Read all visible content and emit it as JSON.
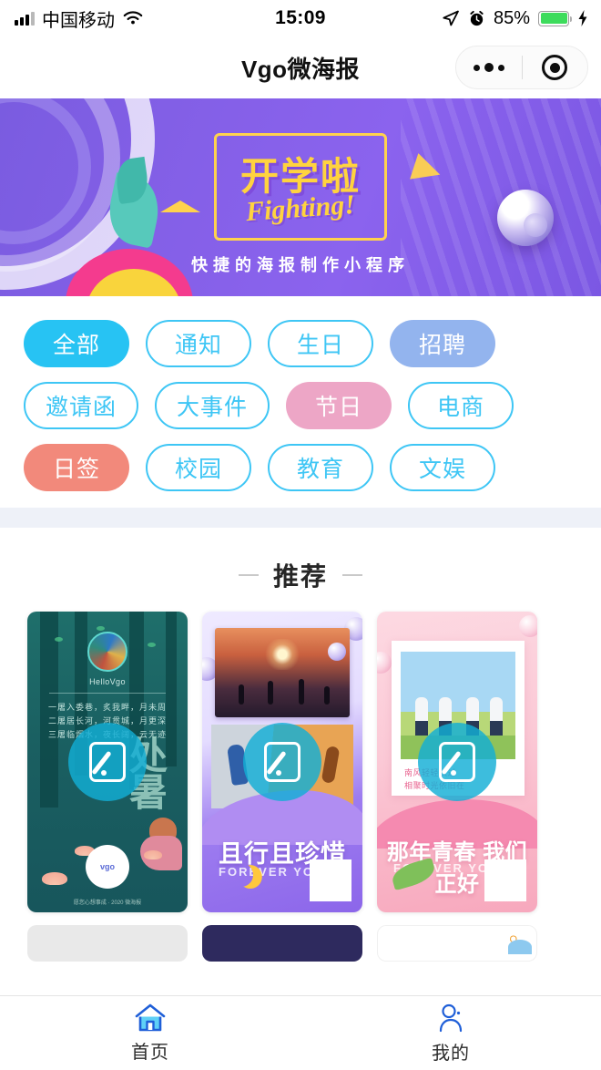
{
  "status_bar": {
    "carrier": "中国移动",
    "time": "15:09",
    "battery_percent": "85%",
    "icons": [
      "signal-bars-icon",
      "wifi-icon",
      "location-arrow-icon",
      "alarm-clock-icon",
      "battery-icon",
      "charging-bolt-icon"
    ]
  },
  "nav": {
    "title": "Vgo微海报",
    "more_icon": "more-dots-icon",
    "close_icon": "target-circle-icon"
  },
  "banner": {
    "title": "开学啦",
    "subtitle": "Fighting!",
    "tagline": "快捷的海报制作小程序",
    "bg_color": "#8560e8",
    "accent_color": "#ffd33f"
  },
  "filters": {
    "active_index": 0,
    "outline_color": "#3ec6f5",
    "items": [
      {
        "label": "全部",
        "style": "fill",
        "color": "#27c3f3"
      },
      {
        "label": "通知",
        "style": "outline",
        "color": "#3ec6f5"
      },
      {
        "label": "生日",
        "style": "outline",
        "color": "#3ec6f5"
      },
      {
        "label": "招聘",
        "style": "fill",
        "color": "#93b4ee"
      },
      {
        "label": "邀请函",
        "style": "outline",
        "color": "#3ec6f5"
      },
      {
        "label": "大事件",
        "style": "outline",
        "color": "#3ec6f5"
      },
      {
        "label": "节日",
        "style": "fill",
        "color": "#eda6c6"
      },
      {
        "label": "电商",
        "style": "outline",
        "color": "#3ec6f5"
      },
      {
        "label": "日签",
        "style": "fill",
        "color": "#f2897b"
      },
      {
        "label": "校园",
        "style": "outline",
        "color": "#3ec6f5"
      },
      {
        "label": "教育",
        "style": "outline",
        "color": "#3ec6f5"
      },
      {
        "label": "文娱",
        "style": "outline",
        "color": "#3ec6f5"
      }
    ]
  },
  "section": {
    "recommend_title": "推荐"
  },
  "posters": [
    {
      "theme": "chushu-forest",
      "handle": "HelloVgo",
      "poem": "一屠入委巷，炙我畔，月未周\n二屠居长河，河贯城，月更深\n三屠临烟水，夜长阔，云无迹",
      "big_char": "处\n暑",
      "footer": "愿您心想事成 · 2020 微海报",
      "qr_label": "vgo",
      "edit_icon": "edit-pencil-icon"
    },
    {
      "theme": "purple-youth",
      "title": "且行且珍惜",
      "subtitle": "FOREVER YOUNG",
      "edit_icon": "edit-pencil-icon",
      "qr_icon": "qr-code-icon"
    },
    {
      "theme": "pink-youth",
      "title": "那年青春 我们正好",
      "subtitle": "FOREVER YOUNG",
      "caption": "南风轻轻吹过\n相聚时光依旧在",
      "edit_icon": "edit-pencil-icon",
      "qr_icon": "qr-code-icon"
    }
  ],
  "posters_next_row": [
    {
      "color": "#e9e9e9"
    },
    {
      "color": "#2e2a5e"
    },
    {
      "color": "#ffffff"
    }
  ],
  "tabbar": {
    "active_index": 0,
    "active_color": "#1f5fd8",
    "items": [
      {
        "label": "首页",
        "icon": "home-icon"
      },
      {
        "label": "我的",
        "icon": "user-icon"
      }
    ]
  }
}
